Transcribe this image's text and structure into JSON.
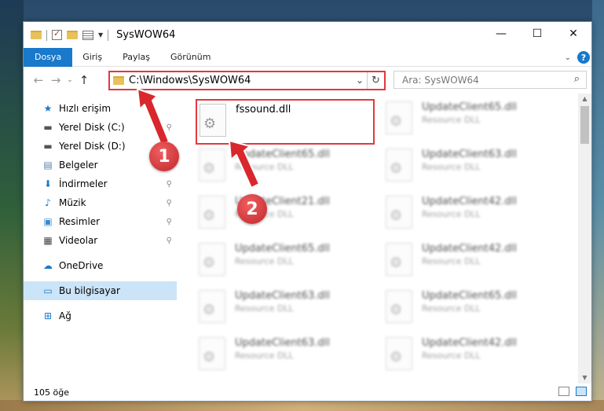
{
  "window": {
    "title": "SysWOW64",
    "controls": {
      "minimize": "—",
      "maximize": "☐",
      "close": "✕"
    }
  },
  "ribbon": {
    "tabs": [
      {
        "label": "Dosya",
        "active": true
      },
      {
        "label": "Giriş"
      },
      {
        "label": "Paylaş"
      },
      {
        "label": "Görünüm"
      }
    ],
    "help": "?"
  },
  "address_bar": {
    "path": "C:\\Windows\\SysWOW64",
    "back": "←",
    "forward": "→",
    "recent": "⌄",
    "up": "↑",
    "refresh": "↻"
  },
  "search": {
    "placeholder": "Ara: SysWOW64",
    "icon": "⌕"
  },
  "nav_pane": {
    "items": [
      {
        "label": "Hızlı erişim",
        "icon": "★",
        "icon_color": "#1979ca"
      },
      {
        "label": "Yerel Disk (C:)",
        "icon": "▬",
        "icon_color": "#555",
        "pinned": true
      },
      {
        "label": "Yerel Disk (D:)",
        "icon": "▬",
        "icon_color": "#555"
      },
      {
        "label": "Belgeler",
        "icon": "▤",
        "icon_color": "#5a7fa8"
      },
      {
        "label": "İndirmeler",
        "icon": "⬇",
        "icon_color": "#1979ca",
        "pinned": true
      },
      {
        "label": "Müzik",
        "icon": "♪",
        "icon_color": "#1979ca",
        "pinned": true
      },
      {
        "label": "Resimler",
        "icon": "▣",
        "icon_color": "#3a8ad0",
        "pinned": true
      },
      {
        "label": "Videolar",
        "icon": "▦",
        "icon_color": "#444",
        "pinned": true
      },
      {
        "label": "OneDrive",
        "icon": "☁",
        "icon_color": "#1979ca"
      },
      {
        "label": "Bu bilgisayar",
        "icon": "▭",
        "icon_color": "#1979ca",
        "selected": true
      },
      {
        "label": "Ağ",
        "icon": "⊞",
        "icon_color": "#1979ca"
      }
    ],
    "pin_glyph": "📌"
  },
  "files": {
    "highlighted": {
      "name": "fssound.dll",
      "type": ""
    },
    "blurred": [
      {
        "name": "UpdateClient65.dll",
        "type": "Resource DLL"
      },
      {
        "name": "UpdateClient65.dll",
        "type": "Resource DLL"
      },
      {
        "name": "UpdateClient63.dll",
        "type": "Resource DLL"
      },
      {
        "name": "UpdateClient21.dll",
        "type": "Resource DLL"
      },
      {
        "name": "UpdateClient42.dll",
        "type": "Resource DLL"
      },
      {
        "name": "UpdateClient65.dll",
        "type": "Resource DLL"
      },
      {
        "name": "UpdateClient42.dll",
        "type": "Resource DLL"
      },
      {
        "name": "UpdateClient63.dll",
        "type": "Resource DLL"
      },
      {
        "name": "UpdateClient65.dll",
        "type": "Resource DLL"
      },
      {
        "name": "UpdateClient63.dll",
        "type": "Resource DLL"
      },
      {
        "name": "UpdateClient42.dll",
        "type": "Resource DLL"
      }
    ]
  },
  "status_bar": {
    "count": "105 öğe"
  },
  "markers": {
    "one": "1",
    "two": "2"
  },
  "colors": {
    "accent": "#1979ca",
    "highlight": "#e0393e"
  }
}
